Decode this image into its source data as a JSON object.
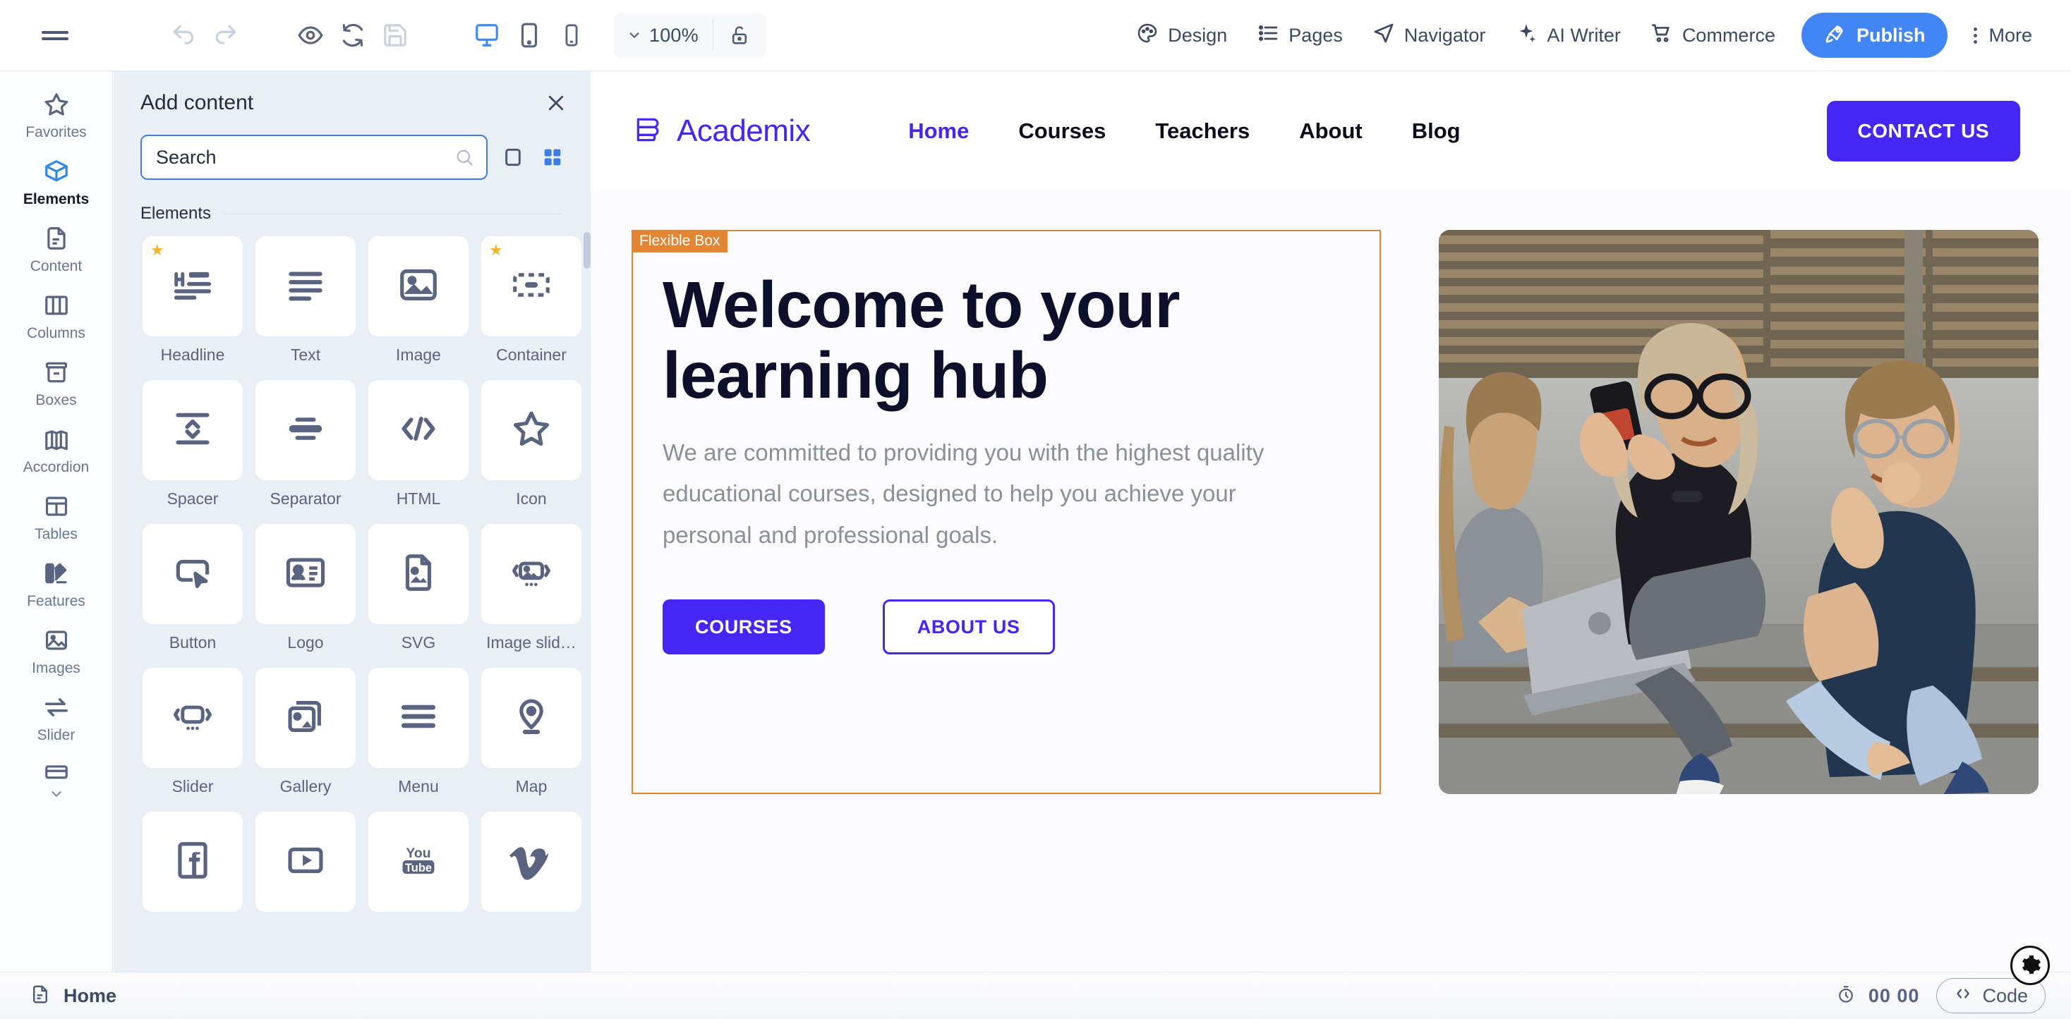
{
  "toolbar": {
    "menu_icon": "hamburger-menu-icon",
    "undo_icon": "undo-icon",
    "redo_icon": "redo-icon",
    "preview_icon": "eye-preview-icon",
    "reload_icon": "reload-icon",
    "save_icon": "save-icon",
    "desktop_icon": "desktop-view-icon",
    "tablet_icon": "tablet-view-icon",
    "mobile_icon": "mobile-view-icon",
    "zoom_value": "100%",
    "lock_icon": "unlock-icon",
    "items": [
      {
        "label": "Design",
        "icon": "palette-icon"
      },
      {
        "label": "Pages",
        "icon": "list-icon"
      },
      {
        "label": "Navigator",
        "icon": "navigator-cursor-icon"
      },
      {
        "label": "AI Writer",
        "icon": "sparkle-icon"
      },
      {
        "label": "Commerce",
        "icon": "shopping-cart-icon"
      }
    ],
    "publish_label": "Publish",
    "publish_icon": "rocket-icon",
    "more_label": "More",
    "more_icon": "three-dots-vertical-icon",
    "accent_color": "#4285f4"
  },
  "rail": {
    "items": [
      {
        "label": "Favorites",
        "icon": "star-icon",
        "active": false
      },
      {
        "label": "Elements",
        "icon": "cube-icon",
        "active": true
      },
      {
        "label": "Content",
        "icon": "document-icon",
        "active": false
      },
      {
        "label": "Columns",
        "icon": "columns-icon",
        "active": false
      },
      {
        "label": "Boxes",
        "icon": "box-icon",
        "active": false
      },
      {
        "label": "Accordion",
        "icon": "accordion-icon",
        "active": false
      },
      {
        "label": "Tables",
        "icon": "table-icon",
        "active": false
      },
      {
        "label": "Features",
        "icon": "features-palette-icon",
        "active": false
      },
      {
        "label": "Images",
        "icon": "image-icon",
        "active": false
      },
      {
        "label": "Slider",
        "icon": "arrows-swap-icon",
        "active": false
      }
    ],
    "more_chevron_icon": "chevron-down-icon"
  },
  "panel": {
    "title": "Add content",
    "close_icon": "close-icon",
    "search": {
      "placeholder": "Search",
      "value": "",
      "icon": "search-icon"
    },
    "view_list_icon": "list-view-icon",
    "view_grid_icon": "grid-view-icon",
    "section_title": "Elements",
    "elements": [
      {
        "label": "Headline",
        "icon": "headline-icon",
        "favorite": true
      },
      {
        "label": "Text",
        "icon": "text-lines-icon",
        "favorite": false
      },
      {
        "label": "Image",
        "icon": "image-icon",
        "favorite": false
      },
      {
        "label": "Container",
        "icon": "container-icon",
        "favorite": true
      },
      {
        "label": "Spacer",
        "icon": "spacer-icon",
        "favorite": false
      },
      {
        "label": "Separator",
        "icon": "separator-icon",
        "favorite": false
      },
      {
        "label": "HTML",
        "icon": "code-brackets-icon",
        "favorite": false
      },
      {
        "label": "Icon",
        "icon": "star-outline-icon",
        "favorite": false
      },
      {
        "label": "Button",
        "icon": "button-icon",
        "favorite": false
      },
      {
        "label": "Logo",
        "icon": "logo-card-icon",
        "favorite": false
      },
      {
        "label": "SVG",
        "icon": "svg-file-icon",
        "favorite": false
      },
      {
        "label": "Image slid…",
        "icon": "image-slider-icon",
        "favorite": false
      },
      {
        "label": "Slider",
        "icon": "slider-icon",
        "favorite": false
      },
      {
        "label": "Gallery",
        "icon": "gallery-icon",
        "favorite": false
      },
      {
        "label": "Menu",
        "icon": "menu-lines-icon",
        "favorite": false
      },
      {
        "label": "Map",
        "icon": "map-pin-icon",
        "favorite": false
      },
      {
        "label": "",
        "icon": "facebook-icon",
        "favorite": false
      },
      {
        "label": "",
        "icon": "video-play-icon",
        "favorite": false
      },
      {
        "label": "",
        "icon": "youtube-icon",
        "favorite": false
      },
      {
        "label": "",
        "icon": "vimeo-icon",
        "favorite": false
      }
    ]
  },
  "site": {
    "brand": {
      "name": "Academix",
      "logo_icon": "academix-book-logo-icon",
      "color": "#4526f5"
    },
    "nav": [
      {
        "label": "Home",
        "active": true
      },
      {
        "label": "Courses",
        "active": false
      },
      {
        "label": "Teachers",
        "active": false
      },
      {
        "label": "About",
        "active": false
      },
      {
        "label": "Blog",
        "active": false
      }
    ],
    "contact_label": "CONTACT US",
    "hero": {
      "selection_tag": "Flexible Box",
      "selection_color": "#e38634",
      "heading": "Welcome to your learning hub",
      "paragraph": "We are committed to providing you with the highest quality educational courses, designed to help you achieve your personal and professional goals.",
      "primary_button": "COURSES",
      "secondary_button": "ABOUT US",
      "image_alt": "three-students-sitting-on-steps-photo"
    }
  },
  "statusbar": {
    "page_icon": "page-document-icon",
    "page_label": "Home",
    "timer_icon": "stopwatch-icon",
    "timer_value": "00 00",
    "code_label": "Code",
    "code_icon": "code-brackets-icon",
    "settings_icon": "gear-icon"
  }
}
